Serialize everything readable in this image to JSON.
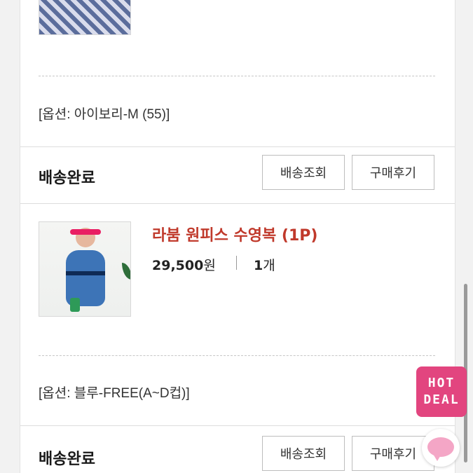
{
  "orders": [
    {
      "option": "[옵션: 아이보리-M (55)]",
      "status": "배송완료",
      "buttons": {
        "track": "배송조회",
        "review": "구매후기"
      }
    },
    {
      "title": "라붐 원피스 수영복 (1P)",
      "price": "29,500",
      "price_unit": "원",
      "qty": "1",
      "qty_unit": "개",
      "option": "[옵션: 블루-FREE(A~D컵)]",
      "status": "배송완료",
      "buttons": {
        "track": "배송조회",
        "review": "구매후기"
      }
    }
  ],
  "hot_deal": {
    "line1": "HOT",
    "line2": "DEAL"
  },
  "colors": {
    "accent": "#c0392b",
    "hotdeal": "#e2457f",
    "chat": "#f4a6c6"
  },
  "icons": [
    "chat-bubble-icon"
  ]
}
